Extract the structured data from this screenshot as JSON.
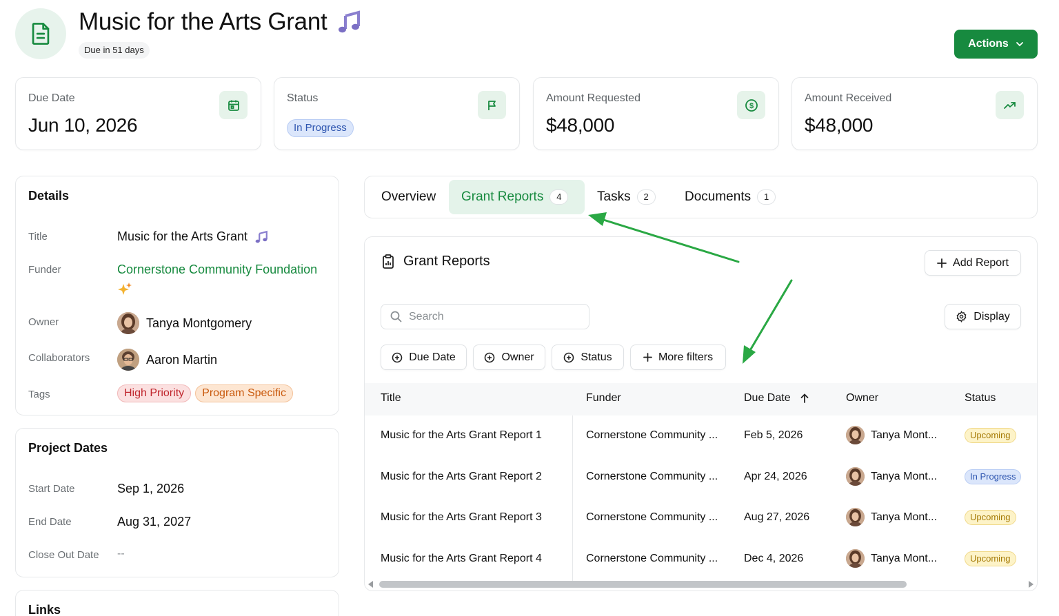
{
  "header": {
    "title": "Music for the Arts Grant",
    "due_chip": "Due in 51 days",
    "actions_label": "Actions"
  },
  "stats": [
    {
      "label": "Due Date",
      "value": "Jun 10, 2026",
      "icon": "calendar-icon"
    },
    {
      "label": "Status",
      "value": "In Progress",
      "icon": "flag-icon"
    },
    {
      "label": "Amount Requested",
      "value": "$48,000",
      "icon": "dollar-circle-icon"
    },
    {
      "label": "Amount Received",
      "value": "$48,000",
      "icon": "trending-up-icon"
    }
  ],
  "details": {
    "heading": "Details",
    "title_label": "Title",
    "title_value": "Music for the Arts Grant",
    "funder_label": "Funder",
    "funder_value": "Cornerstone Community Foundation",
    "owner_label": "Owner",
    "owner_value": "Tanya Montgomery",
    "collaborators_label": "Collaborators",
    "collaborators_value": "Aaron Martin",
    "tags_label": "Tags",
    "tags": [
      "High Priority",
      "Program Specific"
    ]
  },
  "project_dates": {
    "heading": "Project Dates",
    "start_label": "Start Date",
    "start_value": "Sep 1, 2026",
    "end_label": "End Date",
    "end_value": "Aug 31, 2027",
    "close_label": "Close Out Date",
    "close_value": "--"
  },
  "links": {
    "heading": "Links"
  },
  "tabs": [
    {
      "label": "Overview",
      "count": null
    },
    {
      "label": "Grant Reports",
      "count": "4"
    },
    {
      "label": "Tasks",
      "count": "2"
    },
    {
      "label": "Documents",
      "count": "1"
    }
  ],
  "reports": {
    "heading": "Grant Reports",
    "add_label": "Add Report",
    "display_label": "Display",
    "search_placeholder": "Search",
    "filters": [
      "Due Date",
      "Owner",
      "Status",
      "More filters"
    ],
    "columns": [
      "Title",
      "Funder",
      "Due Date",
      "Owner",
      "Status"
    ],
    "rows": [
      {
        "title": "Music for the Arts Grant Report 1",
        "funder": "Cornerstone Community ...",
        "due": "Feb 5, 2026",
        "owner": "Tanya Mont...",
        "status": "Upcoming"
      },
      {
        "title": "Music for the Arts Grant Report 2",
        "funder": "Cornerstone Community ...",
        "due": "Apr 24, 2026",
        "owner": "Tanya Mont...",
        "status": "In Progress"
      },
      {
        "title": "Music for the Arts Grant Report 3",
        "funder": "Cornerstone Community ...",
        "due": "Aug 27, 2026",
        "owner": "Tanya Mont...",
        "status": "Upcoming"
      },
      {
        "title": "Music for the Arts Grant Report 4",
        "funder": "Cornerstone Community ...",
        "due": "Dec 4, 2026",
        "owner": "Tanya Mont...",
        "status": "Upcoming"
      }
    ]
  },
  "colors": {
    "accent_green": "#178a3f",
    "soft_green": "#e4f3ea",
    "status_blue": "#2f56b0",
    "upcoming_yellow": "#a57a05",
    "annotation_arrow": "#2aa844"
  }
}
